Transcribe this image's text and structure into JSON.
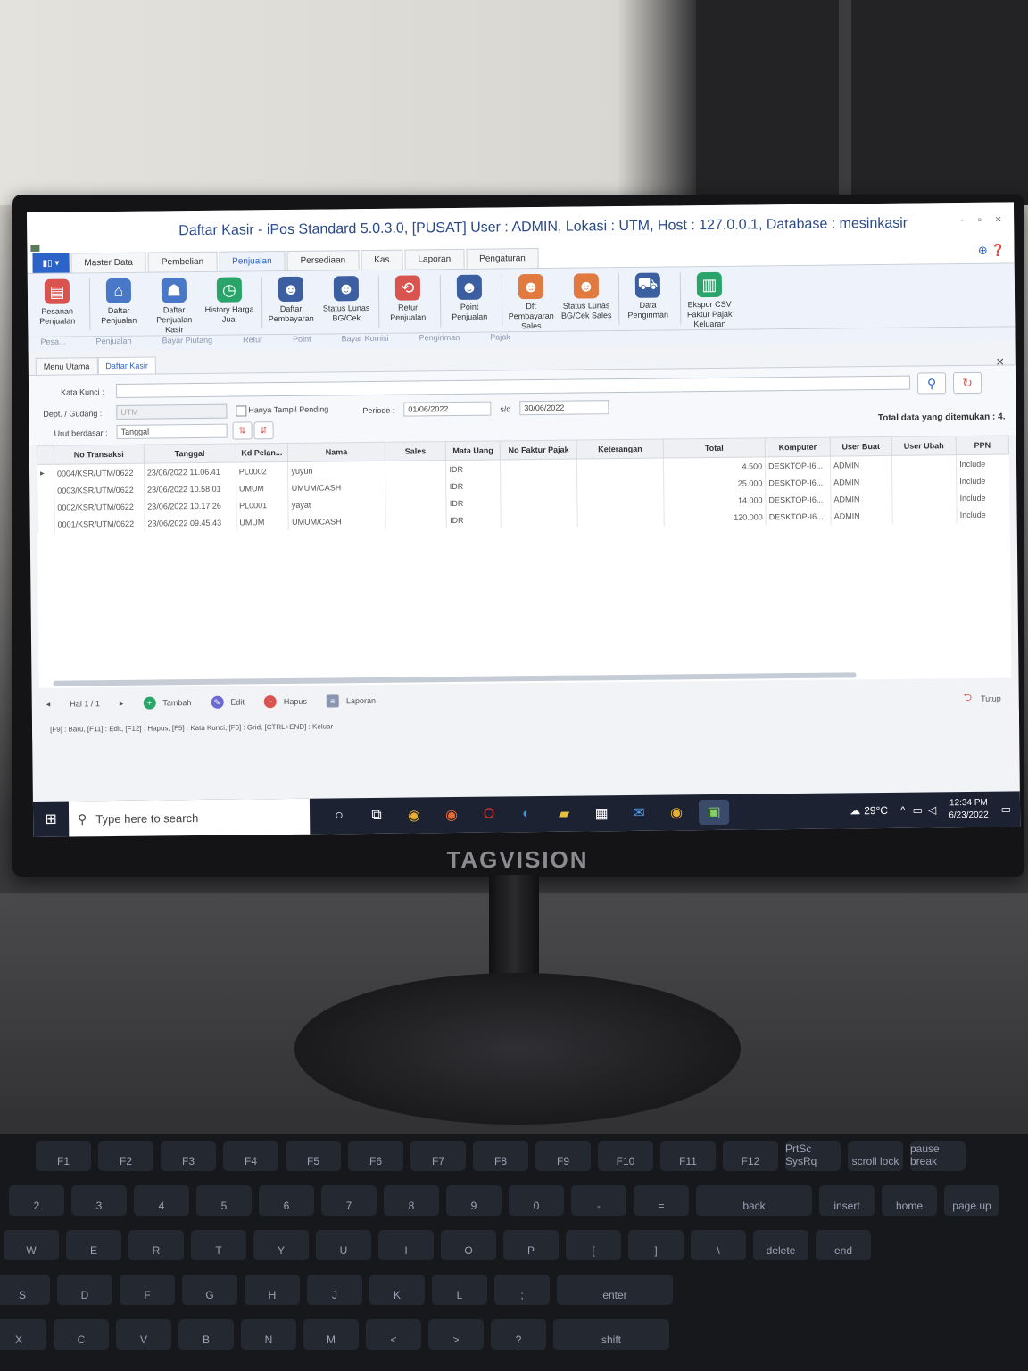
{
  "window": {
    "title": "Daftar Kasir - iPos Standard 5.0.3.0, [PUSAT] User : ADMIN, Lokasi : UTM, Host : 127.0.0.1, Database : mesinkasir",
    "controls": "- ▫ ×"
  },
  "ribbon_tabs": [
    {
      "label": "▮▯ ▾",
      "active": false
    },
    {
      "label": "Master Data",
      "active": false
    },
    {
      "label": "Pembelian",
      "active": false
    },
    {
      "label": "Penjualan",
      "active": true
    },
    {
      "label": "Persediaan",
      "active": false
    },
    {
      "label": "Kas",
      "active": false
    },
    {
      "label": "Laporan",
      "active": false
    },
    {
      "label": "Pengaturan",
      "active": false
    }
  ],
  "ribbon_buttons": [
    {
      "label": "Pesanan Penjualan",
      "icon": "order-icon",
      "color": "#d9534f"
    },
    {
      "label": "Daftar Penjualan",
      "icon": "cart-icon",
      "color": "#4a78c8"
    },
    {
      "label": "Daftar Penjualan Kasir",
      "icon": "cashier-icon",
      "color": "#4a78c8"
    },
    {
      "label": "History Harga Jual",
      "icon": "history-icon",
      "color": "#2aa56a"
    },
    {
      "label": "Daftar Pembayaran",
      "icon": "user-pay-icon",
      "color": "#3b5fa0"
    },
    {
      "label": "Status Lunas BG/Cek",
      "icon": "user-check-icon",
      "color": "#3b5fa0"
    },
    {
      "label": "Retur Penjualan",
      "icon": "return-icon",
      "color": "#d9534f"
    },
    {
      "label": "Point Penjualan",
      "icon": "point-icon",
      "color": "#3b5fa0"
    },
    {
      "label": "Dft Pembayaran Sales",
      "icon": "sales-pay-icon",
      "color": "#e07a40"
    },
    {
      "label": "Status Lunas BG/Cek Sales",
      "icon": "sales-check-icon",
      "color": "#e07a40"
    },
    {
      "label": "Data Pengiriman",
      "icon": "delivery-icon",
      "color": "#3b5fa0"
    },
    {
      "label": "Ekspor CSV Faktur Pajak Keluaran",
      "icon": "csv-icon",
      "color": "#2aa56a"
    }
  ],
  "ribbon_groups": [
    "Pesa...",
    "Penjualan",
    "Bayar Piutang",
    "Retur",
    "Point",
    "Bayar Komisi",
    "Pengiriman",
    "Pajak"
  ],
  "doc_tabs": [
    {
      "label": "Menu Utama",
      "active": false
    },
    {
      "label": "Daftar Kasir",
      "active": true
    }
  ],
  "filters": {
    "kata_kunci_label": "Kata Kunci :",
    "kata_kunci_value": "",
    "dept_label": "Dept. / Gudang :",
    "dept_value": "UTM",
    "hanya_pending_label": "Hanya Tampil Pending",
    "periode_label": "Periode :",
    "periode_from": "01/06/2022",
    "sd_label": "s/d",
    "periode_to": "30/06/2022",
    "urut_label": "Urut berdasar :",
    "urut_value": "Tanggal",
    "total_found": "Total data yang ditemukan : 4."
  },
  "table": {
    "columns": [
      "",
      "No Transaksi",
      "Tanggal",
      "Kd Pelan...",
      "Nama",
      "Sales",
      "Mata Uang",
      "No Faktur Pajak",
      "Keterangan",
      "Total",
      "Komputer",
      "User Buat",
      "User Ubah",
      "PPN"
    ],
    "rows": [
      [
        "▸",
        "0004/KSR/UTM/0622",
        "23/06/2022 11.06.41",
        "PL0002",
        "yuyun",
        "",
        "IDR",
        "",
        "",
        "4.500",
        "DESKTOP-I6...",
        "ADMIN",
        "",
        "Include"
      ],
      [
        "",
        "0003/KSR/UTM/0622",
        "23/06/2022 10.58.01",
        "UMUM",
        "UMUM/CASH",
        "",
        "IDR",
        "",
        "",
        "25.000",
        "DESKTOP-I6...",
        "ADMIN",
        "",
        "Include"
      ],
      [
        "",
        "0002/KSR/UTM/0622",
        "23/06/2022 10.17.26",
        "PL0001",
        "yayat",
        "",
        "IDR",
        "",
        "",
        "14.000",
        "DESKTOP-I6...",
        "ADMIN",
        "",
        "Include"
      ],
      [
        "",
        "0001/KSR/UTM/0622",
        "23/06/2022 09.45.43",
        "UMUM",
        "UMUM/CASH",
        "",
        "IDR",
        "",
        "",
        "120.000",
        "DESKTOP-I6...",
        "ADMIN",
        "",
        "Include"
      ]
    ]
  },
  "footer": {
    "page": "Hal 1 / 1",
    "tambah": "Tambah",
    "edit": "Edit",
    "hapus": "Hapus",
    "laporan": "Laporan",
    "tutup": "Tutup"
  },
  "status_bar": "[F9] : Baru, [F11] : Edit, [F12] : Hapus, [F5] : Kata Kunci, [F6] : Grid, [CTRL+END] : Keluar",
  "taskbar": {
    "search_placeholder": "Type here to search",
    "weather": "29°C",
    "time": "12:34 PM",
    "date": "6/23/2022"
  },
  "monitor_brand": "TAGVISION",
  "keyboard_rows": [
    [
      "F1",
      "F2",
      "F3",
      "F4",
      "F5",
      "F6",
      "F7",
      "F8",
      "F9",
      "F10",
      "F11",
      "F12",
      "PrtSc SysRq",
      "scroll lock",
      "pause break"
    ],
    [
      "2",
      "3",
      "4",
      "5",
      "6",
      "7",
      "8",
      "9",
      "0",
      "-",
      "=",
      "back",
      "insert",
      "home",
      "page up"
    ],
    [
      "W",
      "E",
      "R",
      "T",
      "Y",
      "U",
      "I",
      "O",
      "P",
      "[",
      "]",
      "\\",
      "delete",
      "end"
    ],
    [
      "S",
      "D",
      "F",
      "G",
      "H",
      "J",
      "K",
      "L",
      ";",
      "enter"
    ],
    [
      "X",
      "C",
      "V",
      "B",
      "N",
      "M",
      "<",
      ">",
      "?",
      "shift"
    ]
  ]
}
